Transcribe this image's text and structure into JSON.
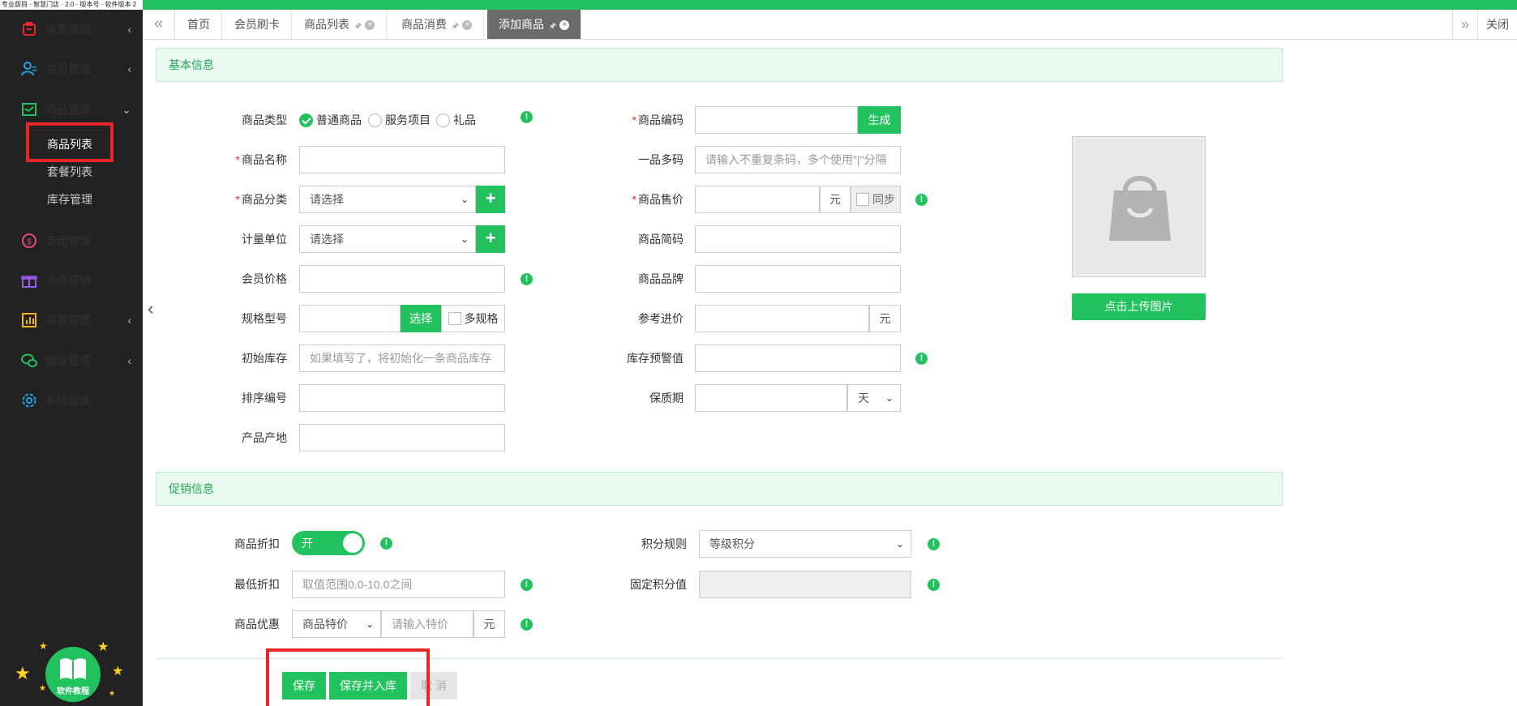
{
  "topstrip": {
    "text": "专业版目 · 智慧门店 · 2.0 · 版本号 · 软件版本 2"
  },
  "sidebar": {
    "items": [
      {
        "label": "消费收银",
        "arrow": "‹"
      },
      {
        "label": "会员管理",
        "arrow": "‹"
      },
      {
        "label": "商品管理",
        "arrow": "⌄"
      },
      {
        "label": "支出管理",
        "arrow": ""
      },
      {
        "label": "会员营销",
        "arrow": ""
      },
      {
        "label": "报表管理",
        "arrow": "‹"
      },
      {
        "label": "微信管理",
        "arrow": "‹"
      },
      {
        "label": "系统设置",
        "arrow": ""
      }
    ],
    "subitems": [
      {
        "label": "商品列表"
      },
      {
        "label": "套餐列表"
      },
      {
        "label": "库存管理"
      }
    ],
    "tutorial_label": "软件教程",
    "colors": {
      "bg": "#222222",
      "accent": "#22c35e",
      "highlight": "#e8262a"
    }
  },
  "tabs": {
    "items": [
      {
        "label": "首页"
      },
      {
        "label": "会员刷卡"
      },
      {
        "label": "商品列表"
      },
      {
        "label": "商品消费"
      },
      {
        "label": "添加商品"
      }
    ],
    "close_label": "关闭"
  },
  "basic": {
    "title": "基本信息",
    "product_type": {
      "label": "商品类型",
      "options": [
        "普通商品",
        "服务项目",
        "礼品"
      ]
    },
    "name": {
      "label": "商品名称",
      "value": ""
    },
    "category": {
      "label": "商品分类",
      "value": "请选择"
    },
    "unit": {
      "label": "计量单位",
      "value": "请选择"
    },
    "member_price": {
      "label": "会员价格",
      "value": ""
    },
    "spec": {
      "label": "规格型号",
      "select_btn": "选择",
      "multi": "多规格"
    },
    "init_stock": {
      "label": "初始库存",
      "placeholder": "如果填写了，将初始化一条商品库存"
    },
    "sort_no": {
      "label": "排序编号"
    },
    "origin": {
      "label": "产品产地"
    },
    "code": {
      "label": "商品编码",
      "generate_btn": "生成"
    },
    "multi_code": {
      "label": "一品多码",
      "placeholder": "请输入不重复条码，多个使用\"|\"分隔"
    },
    "sale_price": {
      "label": "商品售价",
      "unit": "元",
      "sync": "同步"
    },
    "short_code": {
      "label": "商品简码"
    },
    "brand": {
      "label": "商品品牌"
    },
    "ref_price": {
      "label": "参考进价",
      "unit": "元"
    },
    "stock_alert": {
      "label": "库存预警值"
    },
    "shelf_life": {
      "label": "保质期",
      "unit": "天"
    },
    "upload_btn": "点击上传图片"
  },
  "promo": {
    "title": "促销信息",
    "discount": {
      "label": "商品折扣",
      "toggle": "开"
    },
    "min_discount": {
      "label": "最低折扣",
      "placeholder": "取值范围0.0-10.0之间"
    },
    "offer": {
      "label": "商品优惠",
      "select": "商品特价",
      "placeholder": "请输入特价",
      "unit": "元"
    },
    "points_rule": {
      "label": "积分规则",
      "value": "等级积分"
    },
    "fixed_points": {
      "label": "固定积分值"
    }
  },
  "footer": {
    "save": "保存",
    "save_stock": "保存并入库",
    "cancel": "取 消"
  },
  "info_glyph": "!"
}
